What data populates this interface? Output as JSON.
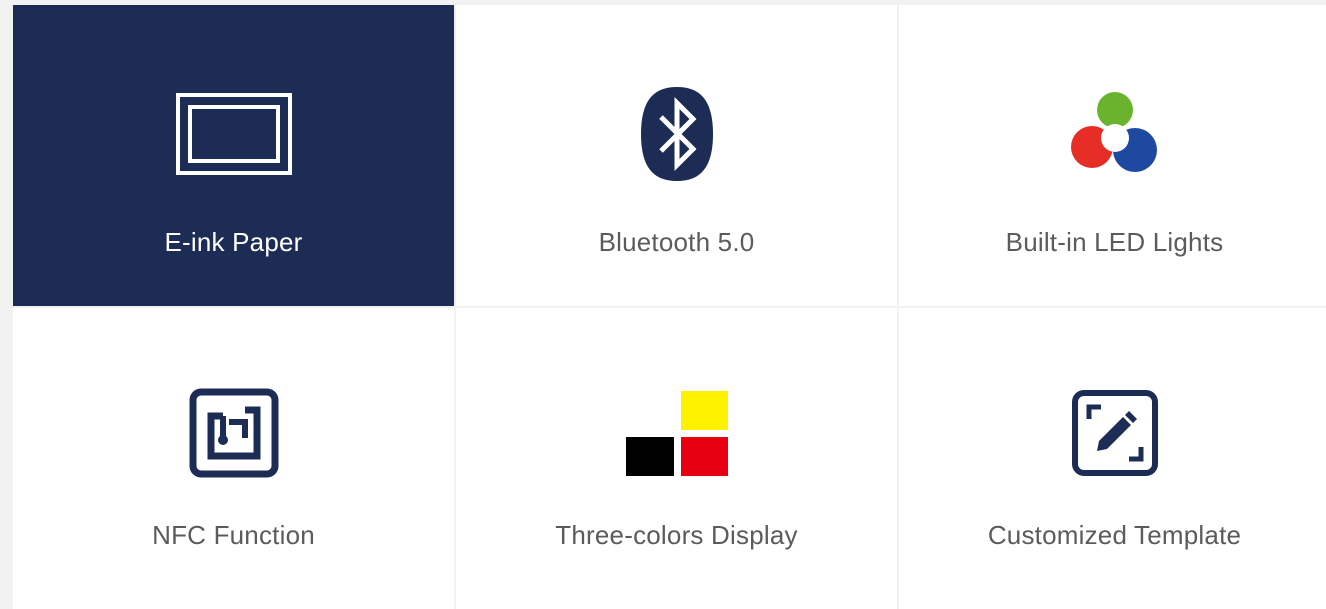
{
  "features": [
    {
      "label": "E-ink Paper",
      "icon": "eink-screen-icon",
      "active": true
    },
    {
      "label": "Bluetooth 5.0",
      "icon": "bluetooth-icon",
      "active": false
    },
    {
      "label": "Built-in LED Lights",
      "icon": "led-lights-icon",
      "active": false
    },
    {
      "label": "NFC Function",
      "icon": "nfc-icon",
      "active": false
    },
    {
      "label": "Three-colors Display",
      "icon": "three-colors-icon",
      "active": false
    },
    {
      "label": "Customized Template",
      "icon": "edit-template-icon",
      "active": false
    }
  ],
  "colors": {
    "navy": "#1c2c54",
    "active_text": "#ffffff",
    "label_text": "#5b5b5b",
    "led_green": "#6ab42d",
    "led_red": "#e62d26",
    "led_blue": "#1d4aa0",
    "display_yellow": "#fff200",
    "display_black": "#000000",
    "display_red": "#e60012"
  }
}
